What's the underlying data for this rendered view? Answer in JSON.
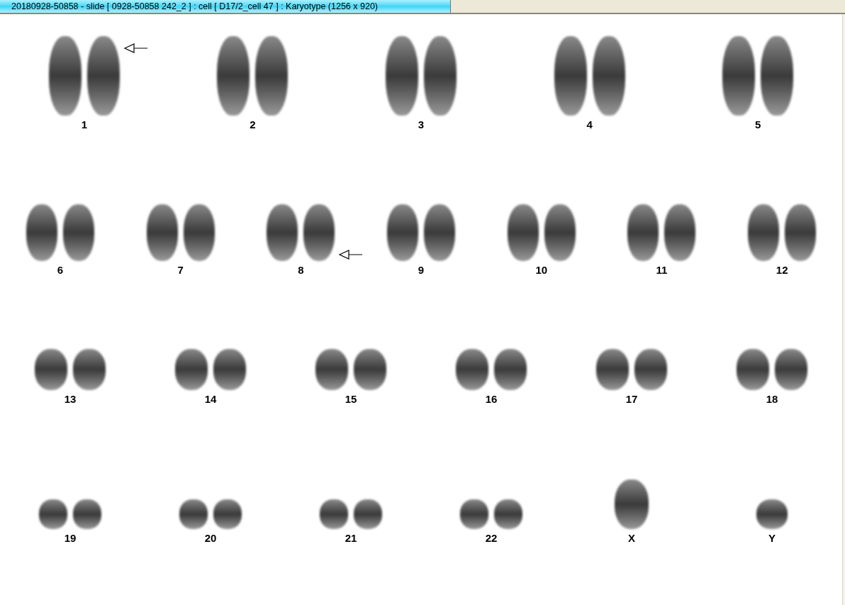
{
  "window": {
    "title": "20180928-50858 - slide [ 0928-50858 242_2 ] : cell [ D17/2_cell 47 ] : Karyotype  (1256 x 920)"
  },
  "rows": [
    {
      "items": [
        {
          "label": "1",
          "kind": "pair",
          "arrow_top": true,
          "arrow_bottom": false
        },
        {
          "label": "2",
          "kind": "pair",
          "arrow_top": false,
          "arrow_bottom": false
        },
        {
          "label": "3",
          "kind": "pair",
          "arrow_top": false,
          "arrow_bottom": false
        },
        {
          "label": "4",
          "kind": "pair",
          "arrow_top": false,
          "arrow_bottom": false
        },
        {
          "label": "5",
          "kind": "pair",
          "arrow_top": false,
          "arrow_bottom": false
        }
      ]
    },
    {
      "items": [
        {
          "label": "6",
          "kind": "pair",
          "arrow_top": false,
          "arrow_bottom": false
        },
        {
          "label": "7",
          "kind": "pair",
          "arrow_top": false,
          "arrow_bottom": false
        },
        {
          "label": "8",
          "kind": "pair",
          "arrow_top": false,
          "arrow_bottom": true
        },
        {
          "label": "9",
          "kind": "pair",
          "arrow_top": false,
          "arrow_bottom": false
        },
        {
          "label": "10",
          "kind": "pair",
          "arrow_top": false,
          "arrow_bottom": false
        },
        {
          "label": "11",
          "kind": "pair",
          "arrow_top": false,
          "arrow_bottom": false
        },
        {
          "label": "12",
          "kind": "pair",
          "arrow_top": false,
          "arrow_bottom": false
        }
      ]
    },
    {
      "items": [
        {
          "label": "13",
          "kind": "pair",
          "arrow_top": false,
          "arrow_bottom": false
        },
        {
          "label": "14",
          "kind": "pair",
          "arrow_top": false,
          "arrow_bottom": false
        },
        {
          "label": "15",
          "kind": "pair",
          "arrow_top": false,
          "arrow_bottom": false
        },
        {
          "label": "16",
          "kind": "pair",
          "arrow_top": false,
          "arrow_bottom": false
        },
        {
          "label": "17",
          "kind": "pair",
          "arrow_top": false,
          "arrow_bottom": false
        },
        {
          "label": "18",
          "kind": "pair",
          "arrow_top": false,
          "arrow_bottom": false
        }
      ]
    },
    {
      "items": [
        {
          "label": "19",
          "kind": "pair",
          "arrow_top": false,
          "arrow_bottom": false
        },
        {
          "label": "20",
          "kind": "pair",
          "arrow_top": false,
          "arrow_bottom": false
        },
        {
          "label": "21",
          "kind": "pair",
          "arrow_top": false,
          "arrow_bottom": false
        },
        {
          "label": "22",
          "kind": "pair",
          "arrow_top": false,
          "arrow_bottom": false
        },
        {
          "label": "X",
          "kind": "single",
          "arrow_top": false,
          "arrow_bottom": false
        },
        {
          "label": "Y",
          "kind": "single",
          "arrow_top": false,
          "arrow_bottom": false
        }
      ]
    }
  ]
}
